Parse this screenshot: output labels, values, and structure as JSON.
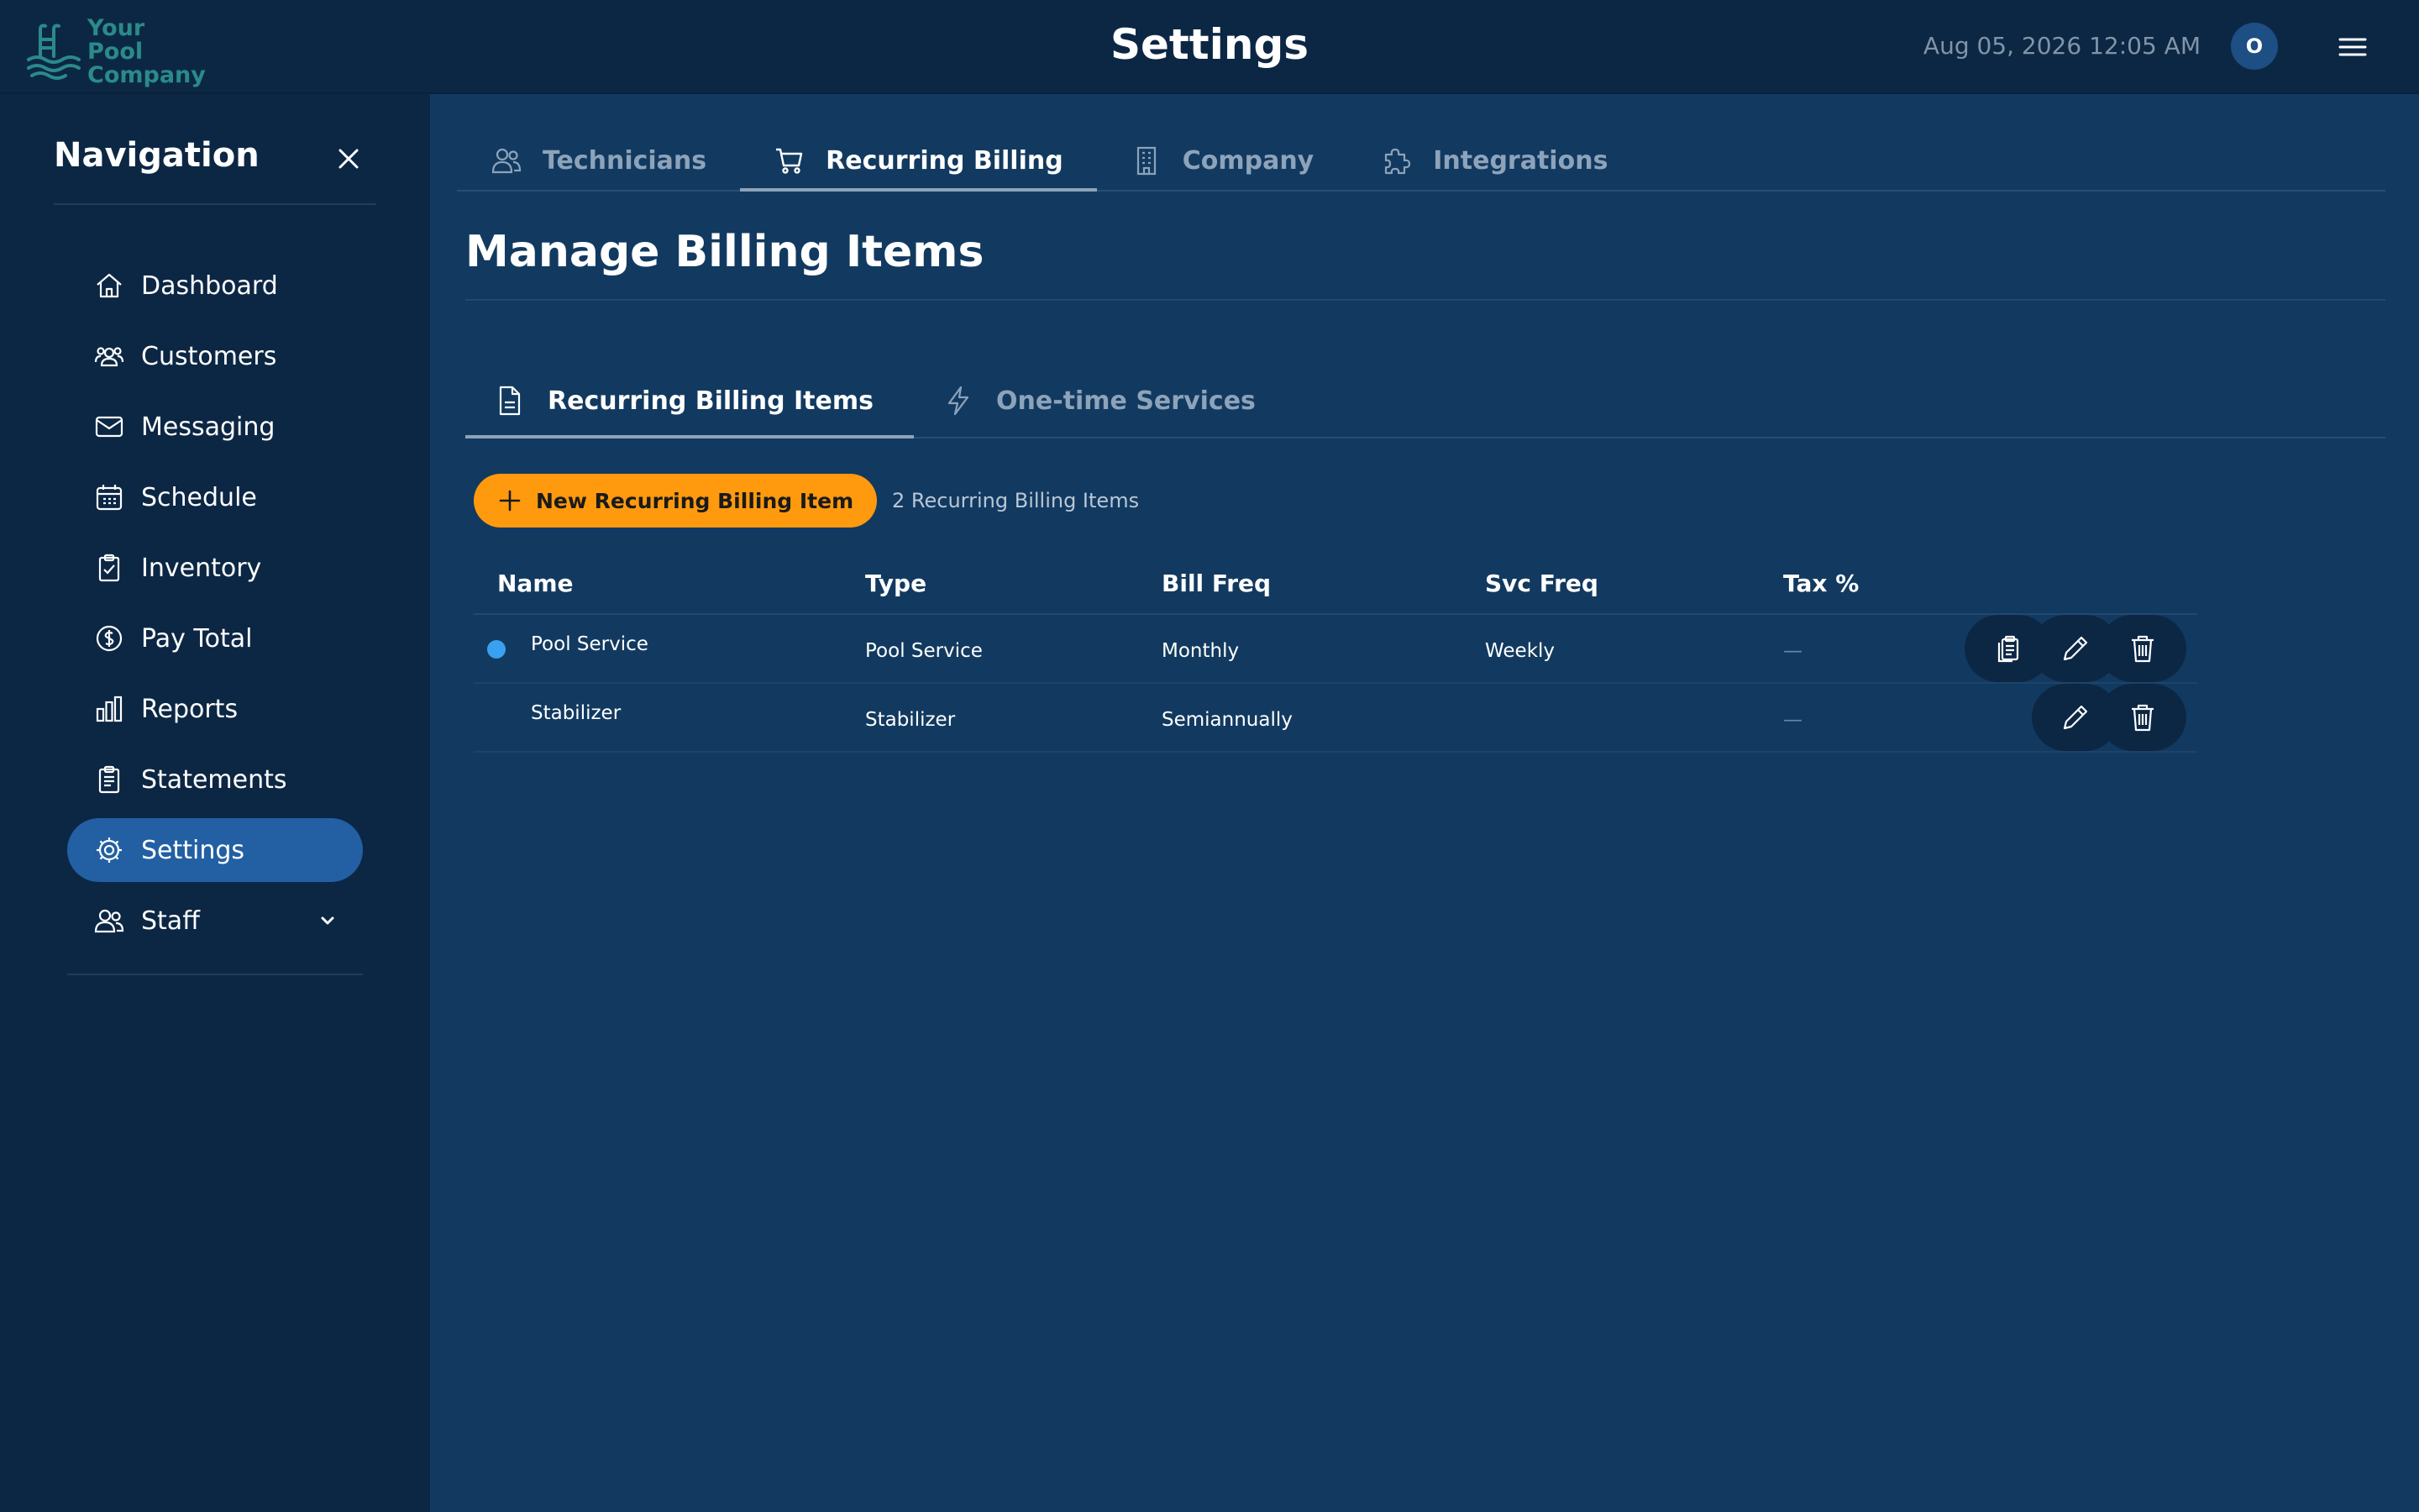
{
  "header": {
    "logo_text": "Your Pool Company",
    "title": "Settings",
    "datetime": "Aug 05, 2026 12:05 AM",
    "avatar_initial": "O"
  },
  "sidebar": {
    "title": "Navigation",
    "items": [
      {
        "label": "Dashboard",
        "icon": "home-icon"
      },
      {
        "label": "Customers",
        "icon": "users-icon"
      },
      {
        "label": "Messaging",
        "icon": "envelope-icon"
      },
      {
        "label": "Schedule",
        "icon": "calendar-icon"
      },
      {
        "label": "Inventory",
        "icon": "clipboard-check-icon"
      },
      {
        "label": "Pay Total",
        "icon": "dollar-circle-icon"
      },
      {
        "label": "Reports",
        "icon": "bar-chart-icon"
      },
      {
        "label": "Statements",
        "icon": "clipboard-list-icon"
      },
      {
        "label": "Settings",
        "icon": "gear-icon",
        "active": true
      },
      {
        "label": "Staff",
        "icon": "staff-icon",
        "expandable": true
      }
    ]
  },
  "tabs": [
    {
      "label": "Technicians",
      "icon": "people-icon"
    },
    {
      "label": "Recurring Billing",
      "icon": "cart-icon",
      "active": true
    },
    {
      "label": "Company",
      "icon": "building-icon"
    },
    {
      "label": "Integrations",
      "icon": "puzzle-icon"
    }
  ],
  "section": {
    "title": "Manage Billing Items",
    "subtabs": [
      {
        "label": "Recurring Billing Items",
        "icon": "document-icon",
        "active": true
      },
      {
        "label": "One-time Services",
        "icon": "lightning-icon"
      }
    ],
    "new_button": "New Recurring Billing Item",
    "count_text": "2 Recurring Billing Items"
  },
  "table": {
    "columns": [
      "Name",
      "Type",
      "Bill Freq",
      "Svc Freq",
      "Tax %"
    ],
    "rows": [
      {
        "name": "Pool Service",
        "type": "Pool Service",
        "bill_freq": "Monthly",
        "svc_freq": "Weekly",
        "tax": "—",
        "marker": true
      },
      {
        "name": "Stabilizer",
        "type": "Stabilizer",
        "bill_freq": "Semiannually",
        "svc_freq": "",
        "tax": "—",
        "marker": false
      }
    ]
  },
  "colors": {
    "background": "#123a60",
    "sidebar": "#0c2744",
    "active_nav": "#2260a3",
    "accent_button": "#ff9a0e",
    "marker_dot": "#3aa0f0",
    "logo": "#2b8a8a"
  }
}
